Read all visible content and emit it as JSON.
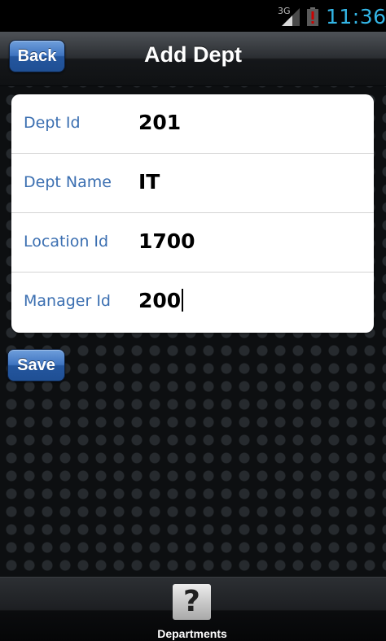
{
  "status_bar": {
    "network_type": "3G",
    "time": "11:36",
    "icons": [
      "signal-icon",
      "battery-alert-icon"
    ]
  },
  "header": {
    "back_label": "Back",
    "title": "Add Dept"
  },
  "form": {
    "fields": [
      {
        "label": "Dept Id",
        "value": "201"
      },
      {
        "label": "Dept Name",
        "value": "IT"
      },
      {
        "label": "Location Id",
        "value": "1700"
      },
      {
        "label": "Manager Id",
        "value": "200"
      }
    ],
    "save_label": "Save"
  },
  "tab_bar": {
    "items": [
      {
        "label": "Departments",
        "icon": "help-icon",
        "glyph": "?"
      }
    ]
  },
  "colors": {
    "status_time": "#33b5e5",
    "button_blue": "#3f74c0",
    "field_label": "#3b6fb1"
  }
}
